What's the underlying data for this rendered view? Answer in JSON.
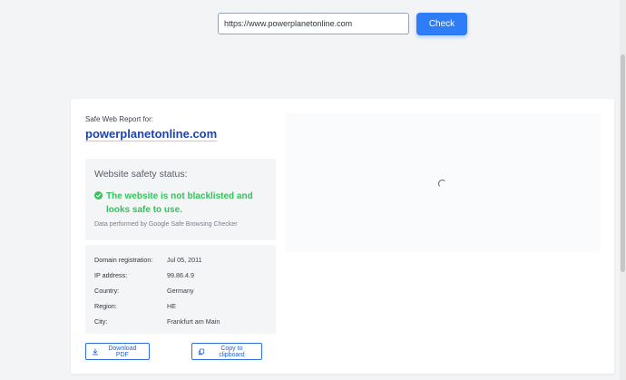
{
  "search": {
    "value": "https://www.powerplanetonline.com",
    "button_label": "Check"
  },
  "report": {
    "header": "Safe Web Report for:",
    "domain": "powerplanetonline.com"
  },
  "safety": {
    "title": "Website safety status:",
    "status_text": "The website is not blacklisted and looks safe to use.",
    "note": "Data performed by Google Safe Browsing Checker",
    "status_color": "#35c25d"
  },
  "info": {
    "rows": [
      {
        "label": "Domain registration:",
        "value": "Jul 05, 2011"
      },
      {
        "label": "IP address:",
        "value": "99.86.4.9"
      },
      {
        "label": "Country:",
        "value": "Germany"
      },
      {
        "label": "Region:",
        "value": "HE"
      },
      {
        "label": "City:",
        "value": "Frankfurt am Main"
      }
    ]
  },
  "actions": {
    "download_label": "Download PDF",
    "copy_label": "Copy to clipboard"
  },
  "icons": {
    "status": "check-circle-icon",
    "download": "download-icon",
    "copy": "copy-icon",
    "loading": "loading-spinner"
  },
  "colors": {
    "accent": "#2f7df6",
    "link": "#1a44b8"
  }
}
